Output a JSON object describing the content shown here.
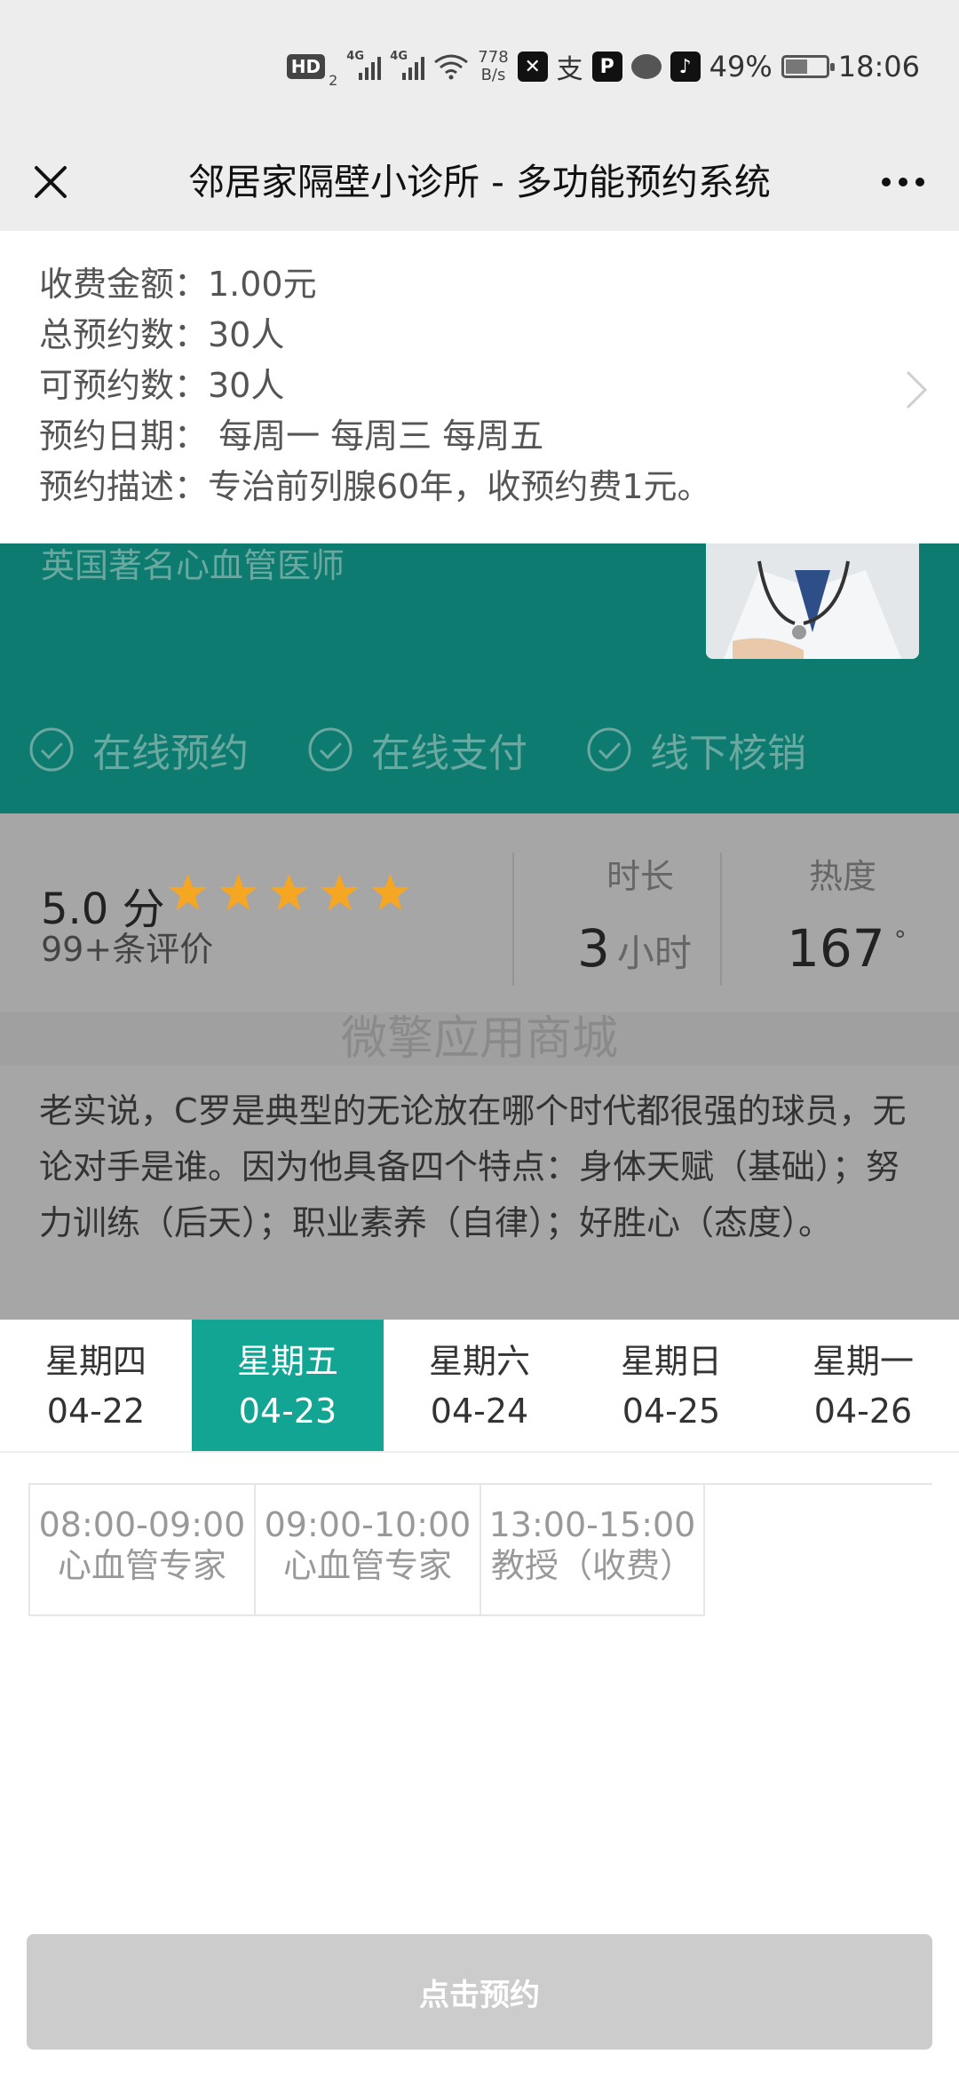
{
  "status_bar": {
    "hd_label": "HD",
    "hd_sub": "2",
    "sig1_label": "4G",
    "sig2_label": "4G",
    "speed_top": "778",
    "speed_bottom": "B/s",
    "battery_pct": "49%",
    "battery_level": 0.49,
    "time": "18:06"
  },
  "nav": {
    "title": "邻居家隔壁小诊所 - 多功能预约系统"
  },
  "info": {
    "fee": "收费金额：1.00元",
    "total": "总预约数：30人",
    "available": "可预约数：30人",
    "dates": "预约日期： 每周一 每周三 每周五",
    "description": "预约描述：专治前列腺60年，收预约费1元。"
  },
  "banner": {
    "subtitle": "英国著名心血管医师",
    "features": [
      "在线预约",
      "在线支付",
      "线下核销"
    ]
  },
  "stats": {
    "rating": "5.0 分",
    "rating_stars": 5,
    "review_count": "99+条评价",
    "duration_label": "时长",
    "duration_value": "3",
    "duration_unit": "小时",
    "heat_label": "热度",
    "heat_value": "167",
    "heat_unit": "°"
  },
  "watermark": "微擎应用商城",
  "description": "老实说，C罗是典型的无论放在哪个时代都很强的球员，无论对手是谁。因为他具备四个特点：身体天赋（基础）；努力训练（后天）；职业素养（自律）；好胜心（态度）。",
  "date_tabs": [
    {
      "weekday": "星期四",
      "date": "04-22"
    },
    {
      "weekday": "星期五",
      "date": "04-23"
    },
    {
      "weekday": "星期六",
      "date": "04-24"
    },
    {
      "weekday": "星期日",
      "date": "04-25"
    },
    {
      "weekday": "星期一",
      "date": "04-26"
    }
  ],
  "slots": [
    {
      "time": "08:00-09:00",
      "name": "心血管专家"
    },
    {
      "time": "09:00-10:00",
      "name": "心血管专家"
    },
    {
      "time": "13:00-15:00",
      "name": "教授（收费）"
    }
  ],
  "book_button": "点击预约",
  "colors": {
    "accent": "#12a594",
    "banner": "#0e7b70",
    "star": "#f5a623",
    "button_disabled": "#cccccc"
  }
}
